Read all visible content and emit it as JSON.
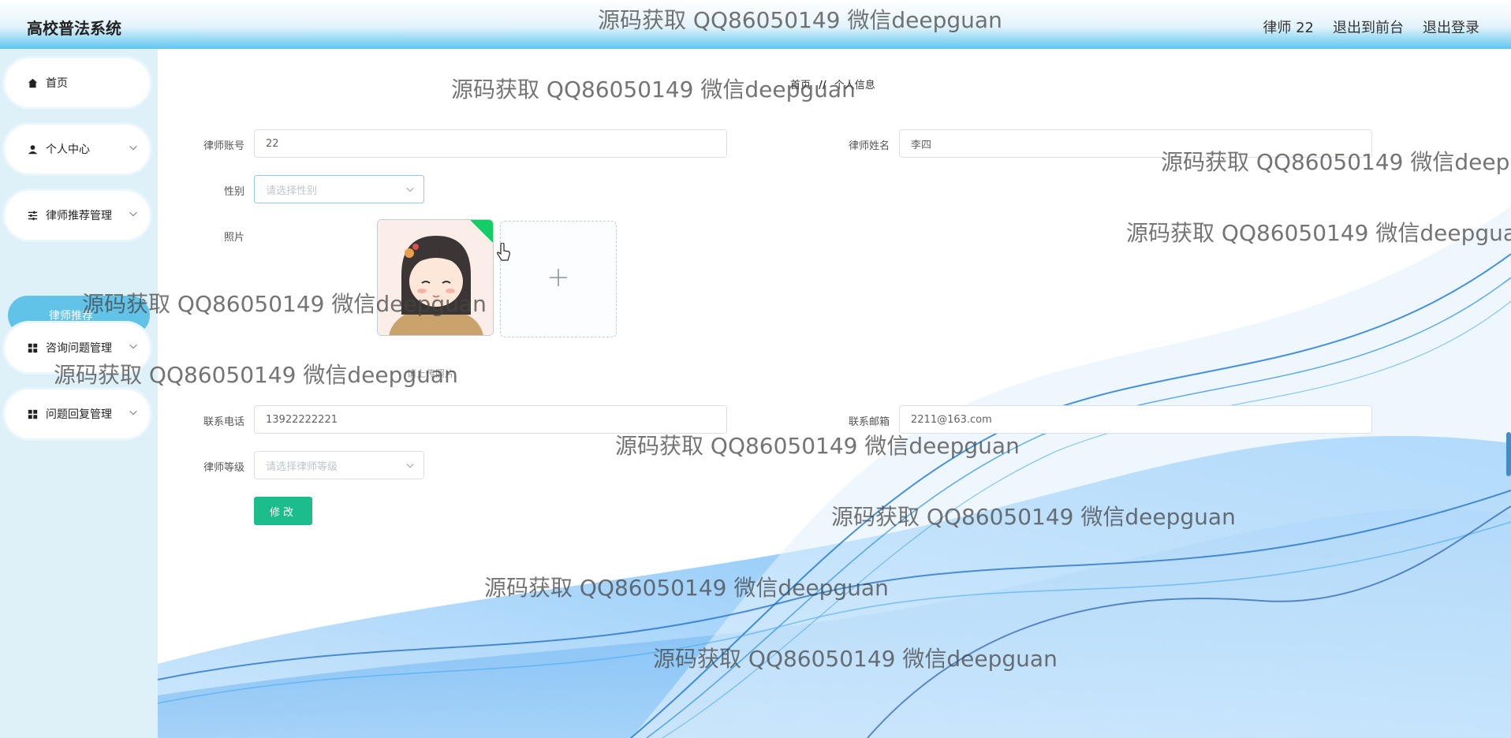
{
  "header": {
    "brand": "高校普法系统",
    "user": "律师 22",
    "to_front": "退出到前台",
    "logout": "退出登录"
  },
  "sidebar": {
    "items": [
      {
        "label": "首页",
        "icon": "home-icon"
      },
      {
        "label": "个人中心",
        "icon": "user-icon"
      },
      {
        "label": "律师推荐管理",
        "icon": "sliders-icon"
      },
      {
        "label": "咨询问题管理",
        "icon": "grid-icon"
      },
      {
        "label": "问题回复管理",
        "icon": "grid-icon"
      }
    ],
    "active_sub": "律师推荐"
  },
  "breadcrumb": {
    "home": "首页",
    "separator": "//",
    "current": "个人信息"
  },
  "form": {
    "account_label": "律师账号",
    "account_value": "22",
    "name_label": "律师姓名",
    "name_value": "李四",
    "gender_label": "性别",
    "gender_placeholder": "请选择性别",
    "photo_label": "照片",
    "photo_hint": "请上传照片",
    "phone_label": "联系电话",
    "phone_value": "13922222221",
    "email_label": "联系邮箱",
    "email_value": "2211@163.com",
    "level_label": "律师等级",
    "level_placeholder": "请选择律师等级",
    "submit_label": "修改"
  },
  "watermark": "源码获取 QQ86050149 微信deepguan",
  "colors": {
    "accent": "#62c3e8",
    "submit": "#1bbd8c",
    "sidebar_bg": "#dff1f8"
  }
}
